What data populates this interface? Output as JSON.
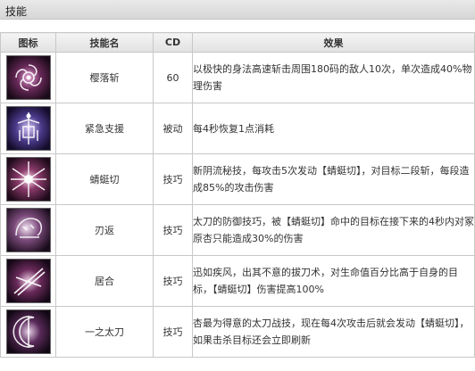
{
  "section": {
    "title": "技能"
  },
  "table": {
    "headers": {
      "icon": "图标",
      "name": "技能名",
      "cd": "CD",
      "effect": "效果"
    },
    "rows": [
      {
        "icon": "sakura-slash-icon",
        "name": "樱落斩",
        "cd": "60",
        "effect": "以极快的身法高速斩击周围180码的敌人10次，单次造成40%物理伤害"
      },
      {
        "icon": "emergency-support-icon",
        "name": "紧急支援",
        "cd": "被动",
        "effect": "每4秒恢复1点消耗"
      },
      {
        "icon": "dragonfly-cut-icon",
        "name": "蜻蜓切",
        "cd": "技巧",
        "effect": "新阴流秘技，每攻击5次发动【蜻蜓切】，对目标二段斩，每段造成85%的攻击伤害"
      },
      {
        "icon": "blade-return-icon",
        "name": "刃返",
        "cd": "技巧",
        "effect": "太刀的防御技巧，被【蜻蜓切】命中的目标在接下来的4秒内对冢原杏只能造成30%的伤害"
      },
      {
        "icon": "iai-icon",
        "name": "居合",
        "cd": "技巧",
        "effect": "迅如疾风，出其不意的拔刀术，对生命值百分比高于自身的目标，【蜻蜓切】伤害提高100%"
      },
      {
        "icon": "ichi-no-tachi-icon",
        "name": "一之太刀",
        "cd": "技巧",
        "effect": "杏最为得意的太刀战技，现在每4次攻击后就会发动【蜻蜓切】，如果击杀目标还会立即刷新"
      }
    ]
  }
}
